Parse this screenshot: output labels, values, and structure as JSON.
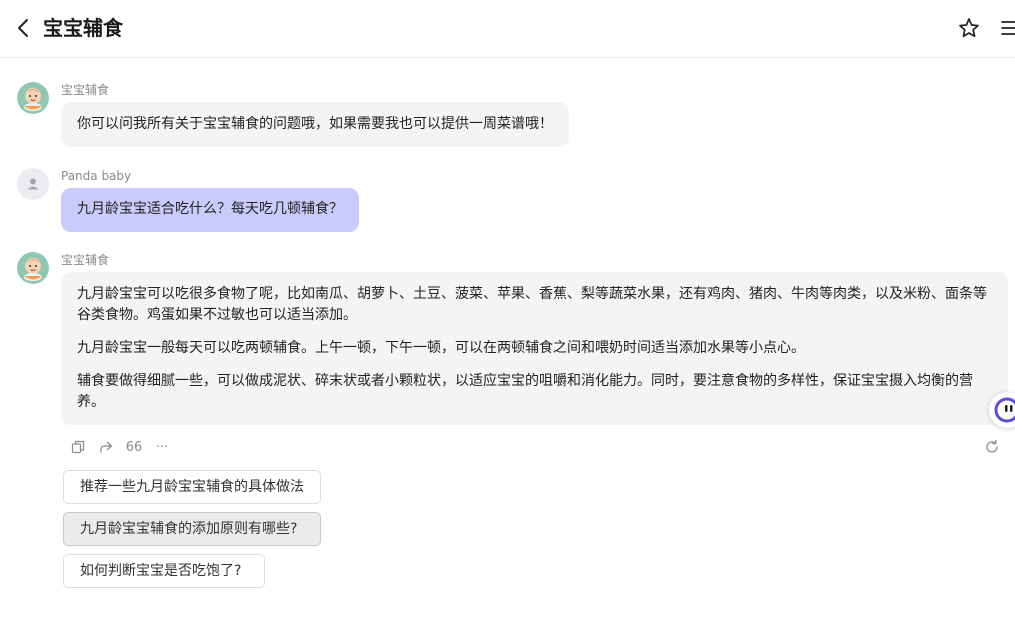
{
  "header": {
    "title": "宝宝辅食",
    "back_icon": "chevron-left-icon",
    "favorite_icon": "star-icon",
    "menu_icon": "menu-icon"
  },
  "messages": [
    {
      "role": "bot",
      "sender": "宝宝辅食",
      "avatar": "baby-food-avatar",
      "paragraphs": [
        "你可以问我所有关于宝宝辅食的问题哦，如果需要我也可以提供一周菜谱哦！"
      ]
    },
    {
      "role": "user",
      "sender": "Panda baby",
      "avatar": "user-avatar",
      "paragraphs": [
        "九月龄宝宝适合吃什么？每天吃几顿辅食？"
      ]
    },
    {
      "role": "bot",
      "sender": "宝宝辅食",
      "avatar": "baby-food-avatar",
      "paragraphs": [
        "九月龄宝宝可以吃很多食物了呢，比如南瓜、胡萝卜、土豆、菠菜、苹果、香蕉、梨等蔬菜水果，还有鸡肉、猪肉、牛肉等肉类，以及米粉、面条等谷类食物。鸡蛋如果不过敏也可以适当添加。",
        "九月龄宝宝一般每天可以吃两顿辅食。上午一顿，下午一顿，可以在两顿辅食之间和喂奶时间适当添加水果等小点心。",
        "辅食要做得细腻一些，可以做成泥状、碎末状或者小颗粒状，以适应宝宝的咀嚼和消化能力。同时，要注意食物的多样性，保证宝宝摄入均衡的营养。"
      ]
    }
  ],
  "actions": {
    "copy_icon": "copy-icon",
    "share_icon": "share-icon",
    "quote_label": "66",
    "more_label": "···",
    "refresh_icon": "refresh-icon"
  },
  "suggestions": [
    "推荐一些九月龄宝宝辅食的具体做法",
    "九月龄宝宝辅食的添加原则有哪些?",
    "如何判断宝宝是否吃饱了?"
  ],
  "colors": {
    "user_bubble": "#c9cbfb",
    "bot_bubble": "#f4f4f5",
    "widget_accent": "#5b4ddb"
  }
}
